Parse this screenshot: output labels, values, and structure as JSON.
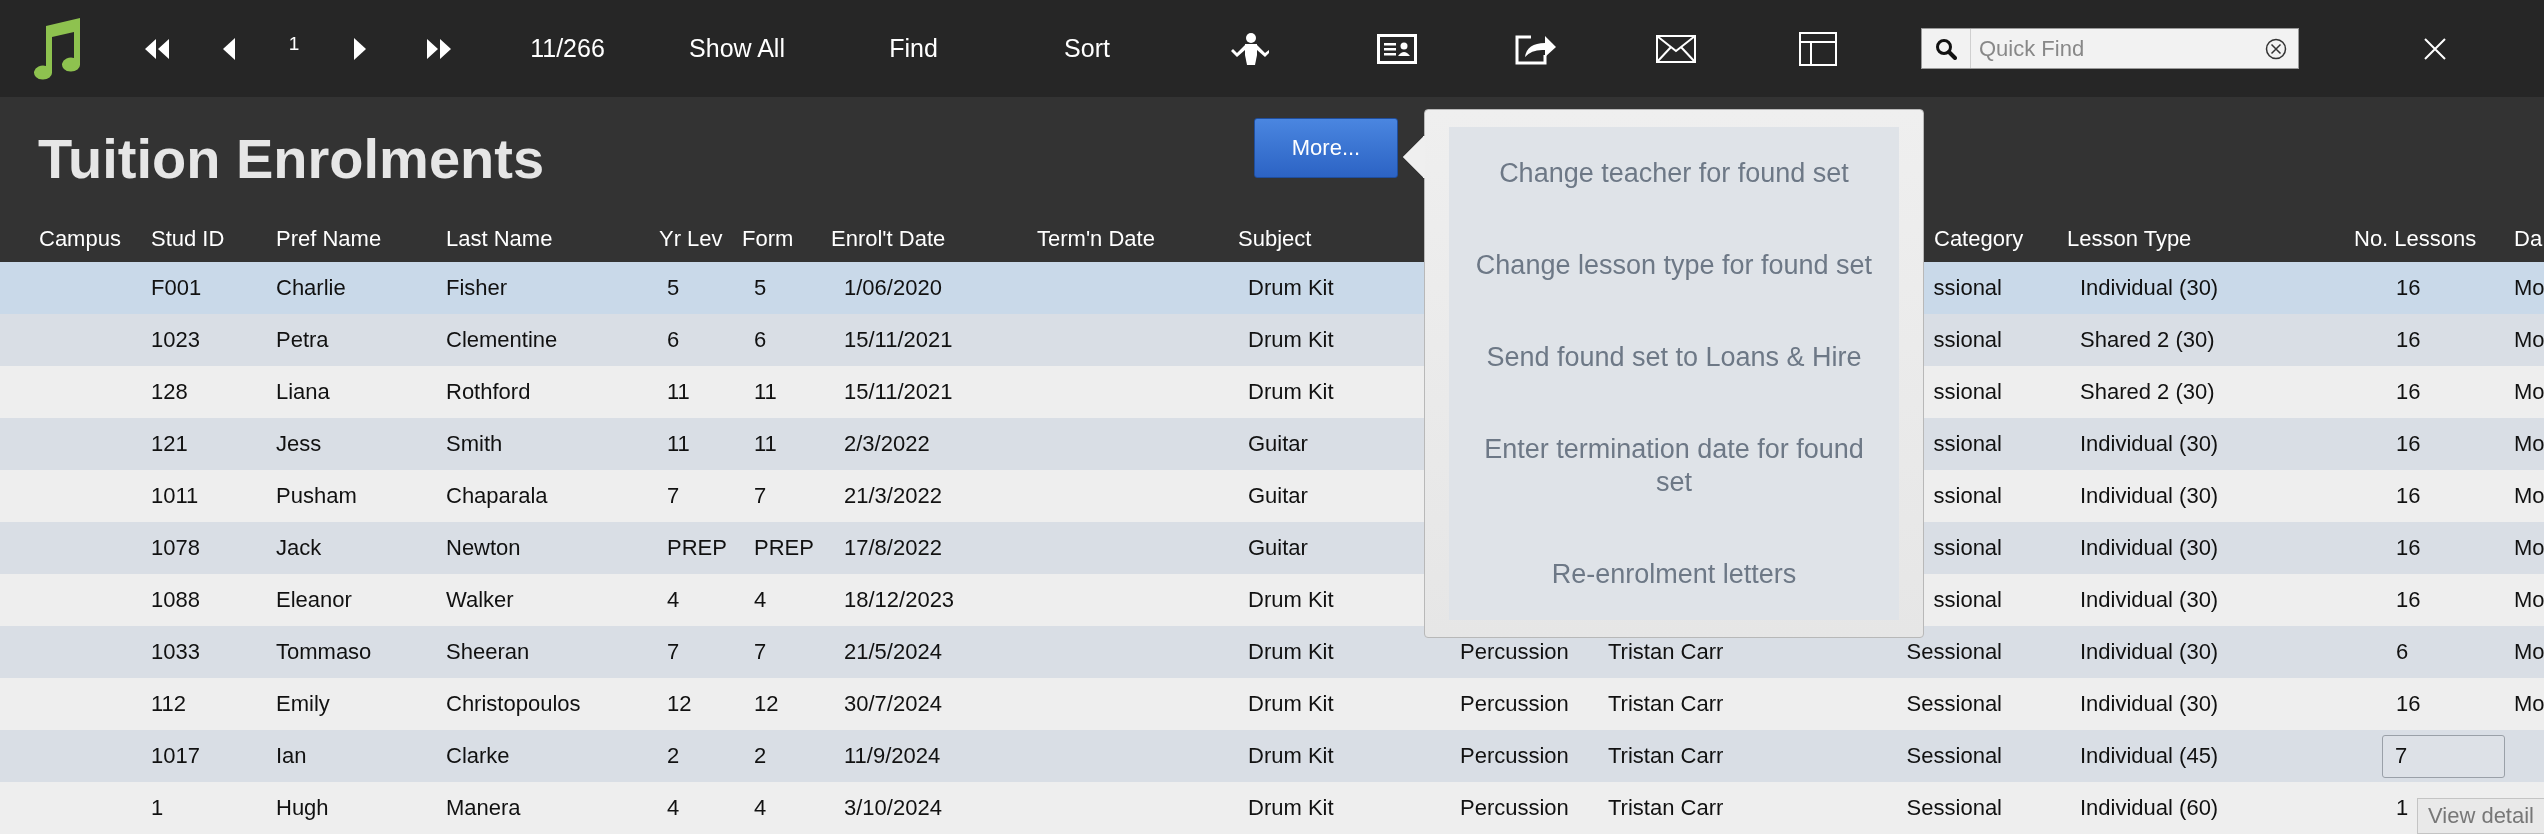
{
  "toolbar": {
    "record_number": "1",
    "record_count": "11/266",
    "buttons": [
      {
        "label": "Show All"
      },
      {
        "label": "Find"
      },
      {
        "label": "Sort"
      }
    ],
    "search": {
      "placeholder": "Quick Find"
    }
  },
  "layout": {
    "title": "Tuition Enrolments",
    "more_button": "More..."
  },
  "popover": {
    "items": [
      "Change teacher for found set",
      "Change lesson type for found set",
      "Send found set to Loans & Hire",
      "Enter termination date for found set",
      "Re-enrolment letters"
    ]
  },
  "table": {
    "columns": [
      "Campus",
      "Stud ID",
      "Pref Name",
      "Last Name",
      "Yr Lev",
      "Form",
      "Enrol't Date",
      "Term'n Date",
      "Subject",
      null,
      null,
      "Category",
      "Lesson Type",
      "No. Lessons",
      "Da"
    ],
    "rows": [
      {
        "selected": true,
        "editing": false,
        "cells": [
          null,
          "F001",
          "Charlie",
          "Fisher",
          "5",
          "5",
          "1/06/2020",
          null,
          "Drum Kit",
          null,
          null,
          "ssional",
          "Individual (30)",
          "16",
          "Mo"
        ]
      },
      {
        "selected": false,
        "editing": false,
        "cells": [
          null,
          "1023",
          "Petra",
          "Clementine",
          "6",
          "6",
          "15/11/2021",
          null,
          "Drum Kit",
          null,
          null,
          "ssional",
          "Shared 2 (30)",
          "16",
          "Mo"
        ]
      },
      {
        "selected": false,
        "editing": false,
        "cells": [
          null,
          "128",
          "Liana",
          "Rothford",
          "11",
          "11",
          "15/11/2021",
          null,
          "Drum Kit",
          null,
          null,
          "ssional",
          "Shared 2 (30)",
          "16",
          "Mo"
        ]
      },
      {
        "selected": false,
        "editing": false,
        "cells": [
          null,
          "121",
          "Jess",
          "Smith",
          "11",
          "11",
          "2/3/2022",
          null,
          "Guitar",
          null,
          null,
          "ssional",
          "Individual (30)",
          "16",
          "Mo"
        ]
      },
      {
        "selected": false,
        "editing": false,
        "cells": [
          null,
          "1011",
          "Pusham",
          "Chaparala",
          "7",
          "7",
          "21/3/2022",
          null,
          "Guitar",
          null,
          null,
          "ssional",
          "Individual (30)",
          "16",
          "Mo"
        ]
      },
      {
        "selected": false,
        "editing": false,
        "cells": [
          null,
          "1078",
          "Jack",
          "Newton",
          "PREP",
          "PREP",
          "17/8/2022",
          null,
          "Guitar",
          null,
          null,
          "ssional",
          "Individual (30)",
          "16",
          "Mo"
        ]
      },
      {
        "selected": false,
        "editing": false,
        "cells": [
          null,
          "1088",
          "Eleanor",
          "Walker",
          "4",
          "4",
          "18/12/2023",
          null,
          "Drum Kit",
          null,
          null,
          "ssional",
          "Individual (30)",
          "16",
          "Mo"
        ]
      },
      {
        "selected": false,
        "editing": false,
        "cells": [
          null,
          "1033",
          "Tommaso",
          "Sheeran",
          "7",
          "7",
          "21/5/2024",
          null,
          "Drum Kit",
          "Percussion",
          "Tristan Carr",
          "Sessional",
          "Individual (30)",
          "6",
          "Mo"
        ]
      },
      {
        "selected": false,
        "editing": false,
        "cells": [
          null,
          "112",
          "Emily",
          "Christopoulos",
          "12",
          "12",
          "30/7/2024",
          null,
          "Drum Kit",
          "Percussion",
          "Tristan Carr",
          "Sessional",
          "Individual (30)",
          "16",
          "Mo"
        ]
      },
      {
        "selected": false,
        "editing": true,
        "cells": [
          null,
          "1017",
          "Ian",
          "Clarke",
          "2",
          "2",
          "11/9/2024",
          null,
          "Drum Kit",
          "Percussion",
          "Tristan Carr",
          "Sessional",
          "Individual (45)",
          "7",
          null
        ]
      },
      {
        "selected": false,
        "editing": false,
        "cells": [
          null,
          "1",
          "Hugh",
          "Manera",
          "4",
          "4",
          "3/10/2024",
          null,
          "Drum Kit",
          "Percussion",
          "Tristan Carr",
          "Sessional",
          "Individual (60)",
          "1",
          null
        ]
      }
    ]
  },
  "tooltip": "View detail"
}
